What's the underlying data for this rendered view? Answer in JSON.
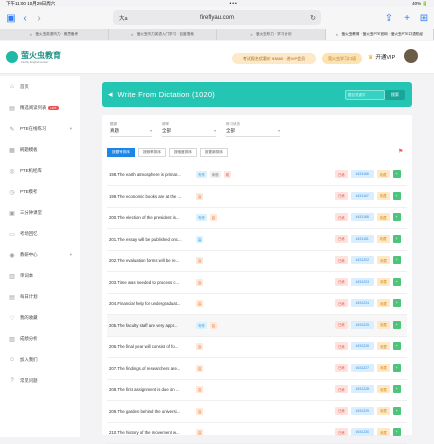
{
  "status_bar": {
    "time": "下午11:00",
    "date": "10月29日周六",
    "dots": "•••",
    "battery": "40% 🔋"
  },
  "browser": {
    "url": "fireflyau.com",
    "aa_label": "大a",
    "tabs": [
      {
        "label": "萤火虫英语听力 · 雅思备考",
        "active": false
      },
      {
        "label": "萤火虫听力英语入门学习 · 百度搜索",
        "active": false
      },
      {
        "label": "萤火虫听力 · 学习计划",
        "active": false
      },
      {
        "label": "萤火虫教育 · 萤火虫PTE官网 · 萤火虫PTE口语机经",
        "active": true
      }
    ]
  },
  "site": {
    "logo_name": "萤火虫教育",
    "logo_sub": "Firefly Englishcenter",
    "promo_pill": "考试报名优惠价 ¥3880 · 进VIP会员",
    "promo_pill2": "萤火虫学习口语",
    "vip_label": "开通VIP"
  },
  "sidebar": {
    "items": [
      {
        "label": "首页",
        "icon": "home-icon",
        "glyph": "⌂"
      },
      {
        "label": "精选阅读列表",
        "icon": "book-icon",
        "glyph": "▤",
        "badge": "HOT"
      },
      {
        "label": "PTE在线练习",
        "icon": "pen-icon",
        "glyph": "✎",
        "chevron": "▾"
      },
      {
        "label": "刷题模板",
        "icon": "template-icon",
        "glyph": "▦"
      },
      {
        "label": "PTE机经库",
        "icon": "bulb-icon",
        "glyph": "◎"
      },
      {
        "label": "PTE模考",
        "icon": "clock-icon",
        "glyph": "◷"
      },
      {
        "label": "三分钟课堂",
        "icon": "video-icon",
        "glyph": "▣"
      },
      {
        "label": "考场回忆",
        "icon": "note-icon",
        "glyph": "▭"
      },
      {
        "label": "教研中心",
        "icon": "globe-icon",
        "glyph": "◉",
        "chevron": "▾"
      },
      {
        "label": "单词本",
        "icon": "wordbook-icon",
        "glyph": "▥"
      },
      {
        "label": "每日计划",
        "icon": "calendar-icon",
        "glyph": "▤"
      },
      {
        "label": "我的收藏",
        "icon": "heart-icon",
        "glyph": "♡"
      },
      {
        "label": "成绩分析",
        "icon": "chart-icon",
        "glyph": "▨"
      },
      {
        "label": "加入我们",
        "icon": "user-icon",
        "glyph": "☺"
      },
      {
        "label": "常见问题",
        "icon": "help-icon",
        "glyph": "?"
      }
    ]
  },
  "banner": {
    "title": "Write From Dictation (1020)",
    "search_placeholder": "题目关键字",
    "search_button": "搜索"
  },
  "filters": [
    {
      "label": "题源",
      "value": "真题"
    },
    {
      "label": "频率",
      "value": "全部"
    },
    {
      "label": "练习状态",
      "value": "全部"
    }
  ],
  "sort_tabs": [
    "按题号排序",
    "按频率排序",
    "按难度排序",
    "按更新排序"
  ],
  "rows": [
    {
      "text": "198.The earth atmosphere is primar...",
      "tags": [
        {
          "t": "写作",
          "c": "blue"
        },
        {
          "t": "黄题",
          "c": "gray"
        },
        {
          "t": "难",
          "c": "red"
        }
      ],
      "code": "#151166"
    },
    {
      "text": "199.The economic books are at the ...",
      "tags": [
        {
          "t": "高",
          "c": "orange"
        }
      ],
      "code": "#151167"
    },
    {
      "text": "200.The election of the president is...",
      "tags": [
        {
          "t": "写作",
          "c": "blue"
        },
        {
          "t": "高",
          "c": "orange"
        }
      ],
      "code": "#151168"
    },
    {
      "text": "201.The essay will be published onc...",
      "tags": [
        {
          "t": "高",
          "c": "blue"
        }
      ],
      "code": "#151181"
    },
    {
      "text": "202.The evaluation forms will be re...",
      "tags": [
        {
          "t": "高",
          "c": "orange"
        }
      ],
      "code": "#151202"
    },
    {
      "text": "203.Time was needed to process c...",
      "tags": [
        {
          "t": "高",
          "c": "orange"
        }
      ],
      "code": "#151203"
    },
    {
      "text": "204.Financial help for undergraduat...",
      "tags": [
        {
          "t": "高",
          "c": "orange"
        }
      ],
      "code": "#151224"
    },
    {
      "text": "205.The faculty staff are very appr...",
      "tags": [
        {
          "t": "写作",
          "c": "blue"
        },
        {
          "t": "高",
          "c": "orange"
        }
      ],
      "code": "#151225",
      "highlight": true
    },
    {
      "text": "206.The final year will consist of fo...",
      "tags": [
        {
          "t": "高",
          "c": "orange"
        }
      ],
      "code": "#151226"
    },
    {
      "text": "207.The findings of researchers are...",
      "tags": [
        {
          "t": "高",
          "c": "orange"
        }
      ],
      "code": "#151227"
    },
    {
      "text": "208.The first assignment is due on ...",
      "tags": [
        {
          "t": "高",
          "c": "orange"
        }
      ],
      "code": "#151228"
    },
    {
      "text": "209.The garden behind the universi...",
      "tags": [
        {
          "t": "高",
          "c": "orange"
        }
      ],
      "code": "#151229"
    },
    {
      "text": "210.The history of the movement w...",
      "tags": [
        {
          "t": "高",
          "c": "orange"
        }
      ],
      "code": "#151230"
    }
  ],
  "row_buttons": {
    "btn1": "已练",
    "btn3": "收藏",
    "btn4": "+"
  },
  "colors": {
    "accent": "#24c5b3",
    "primary": "#1c85e8"
  }
}
